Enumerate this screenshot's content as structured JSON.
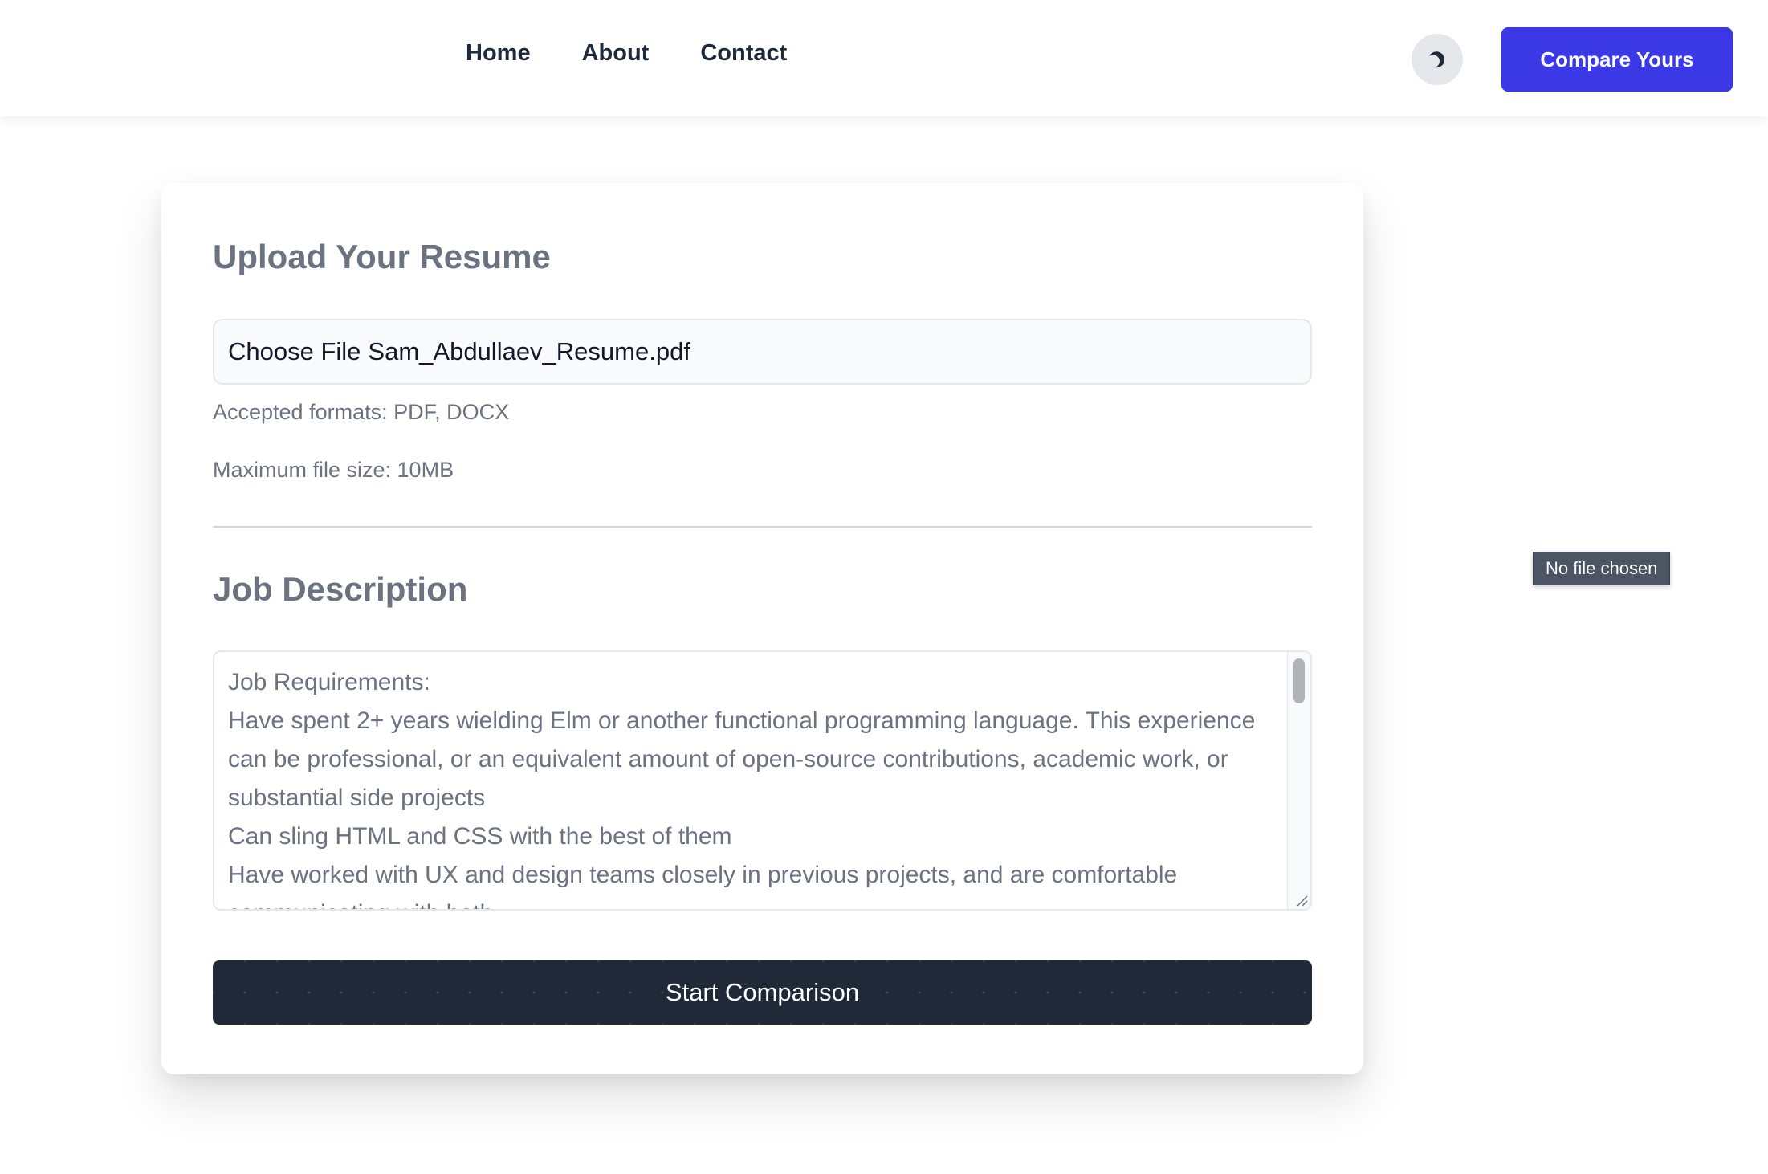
{
  "nav": {
    "items": [
      "Home",
      "About",
      "Contact"
    ]
  },
  "header": {
    "theme_toggle_icon": "moon-icon",
    "cta_label": "Compare Yours",
    "cta_color": "#3b39e6"
  },
  "upload": {
    "title": "Upload Your Resume",
    "file_button_label": "Choose File",
    "file_name": "Sam_Abdullaev_Resume.pdf",
    "accepted_formats": "Accepted formats: PDF, DOCX",
    "max_size": "Maximum file size: 10MB"
  },
  "job": {
    "title": "Job Description",
    "lines": [
      "Job Requirements:",
      "Have spent 2+ years wielding Elm or another functional programming language. This experience",
      "can be professional, or an equivalent amount of open-source contributions, academic work, or",
      "substantial side projects",
      "Can sling HTML and CSS with the best of them",
      "Have worked with UX and design teams closely in previous projects, and are comfortable",
      "communicating with both"
    ]
  },
  "actions": {
    "submit_label": "Start Comparison"
  },
  "tooltip": {
    "text": "No file chosen"
  }
}
